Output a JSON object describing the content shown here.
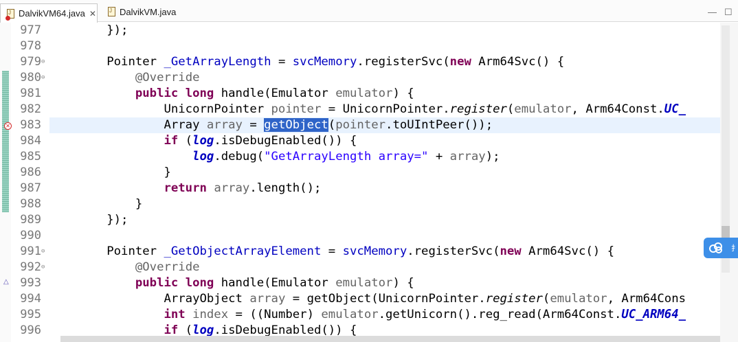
{
  "tabs": [
    {
      "label": "DalvikVM64.java",
      "close": "✕",
      "active": true,
      "error": true
    },
    {
      "label": "DalvikVM.java",
      "active": false,
      "error": false
    }
  ],
  "window": {
    "minimize": "—",
    "maximize": "☐"
  },
  "side_widget": {
    "text": "扌"
  },
  "lines": [
    {
      "n": "977",
      "fold": "",
      "html": "        });"
    },
    {
      "n": "978",
      "fold": "",
      "html": ""
    },
    {
      "n": "979",
      "fold": "⊖",
      "html": "        Pointer <span class=\"fld\">_GetArrayLength</span> = <span class=\"fld\">svcMemory</span>.registerSvc(<span class=\"kw\">new</span> Arm64Svc() {"
    },
    {
      "n": "980",
      "fold": "⊖",
      "html": "            <span class=\"ann\">@Override</span>"
    },
    {
      "n": "981",
      "fold": "",
      "html": "            <span class=\"kw\">public</span> <span class=\"kw\">long</span> handle(Emulator <span class=\"ann\">emulator</span>) {"
    },
    {
      "n": "982",
      "fold": "",
      "html": "                UnicornPointer <span class=\"ann\">pointer</span> = UnicornPointer.<span class=\"stm\">register</span>(<span class=\"ann\">emulator</span>, Arm64Const.<span class=\"st\">UC_</span>"
    },
    {
      "n": "983",
      "fold": "",
      "current": true,
      "html": "                Array <span class=\"ann\">array</span> = <span class=\"hl\">getObject</span>(<span class=\"ann\">pointer</span>.toUIntPeer());"
    },
    {
      "n": "984",
      "fold": "",
      "html": "                <span class=\"kw\">if</span> (<span class=\"st\">log</span>.isDebugEnabled()) {"
    },
    {
      "n": "985",
      "fold": "",
      "html": "                    <span class=\"st\">log</span>.debug(<span class=\"str\">\"GetArrayLength array=\"</span> + <span class=\"ann\">array</span>);"
    },
    {
      "n": "986",
      "fold": "",
      "html": "                }"
    },
    {
      "n": "987",
      "fold": "",
      "html": "                <span class=\"kw\">return</span> <span class=\"ann\">array</span>.length();"
    },
    {
      "n": "988",
      "fold": "",
      "html": "            }"
    },
    {
      "n": "989",
      "fold": "",
      "html": "        });"
    },
    {
      "n": "990",
      "fold": "",
      "html": ""
    },
    {
      "n": "991",
      "fold": "⊖",
      "html": "        Pointer <span class=\"fld\">_GetObjectArrayElement</span> = <span class=\"fld\">svcMemory</span>.registerSvc(<span class=\"kw\">new</span> Arm64Svc() {"
    },
    {
      "n": "992",
      "fold": "⊖",
      "html": "            <span class=\"ann\">@Override</span>"
    },
    {
      "n": "993",
      "fold": "",
      "html": "            <span class=\"kw\">public</span> <span class=\"kw\">long</span> handle(Emulator <span class=\"ann\">emulator</span>) {"
    },
    {
      "n": "994",
      "fold": "",
      "html": "                ArrayObject <span class=\"ann\">array</span> = getObject(UnicornPointer.<span class=\"stm\">register</span>(<span class=\"ann\">emulator</span>, Arm64Cons"
    },
    {
      "n": "995",
      "fold": "",
      "html": "                <span class=\"kw\">int</span> <span class=\"ann\">index</span> = ((Number) <span class=\"ann\">emulator</span>.getUnicorn().reg_read(Arm64Const.<span class=\"st\">UC_ARM64_</span>"
    },
    {
      "n": "996",
      "fold": "",
      "html": "                <span class=\"kw\">if</span> (<span class=\"st\">log</span>.isDebugEnabled()) {"
    }
  ]
}
